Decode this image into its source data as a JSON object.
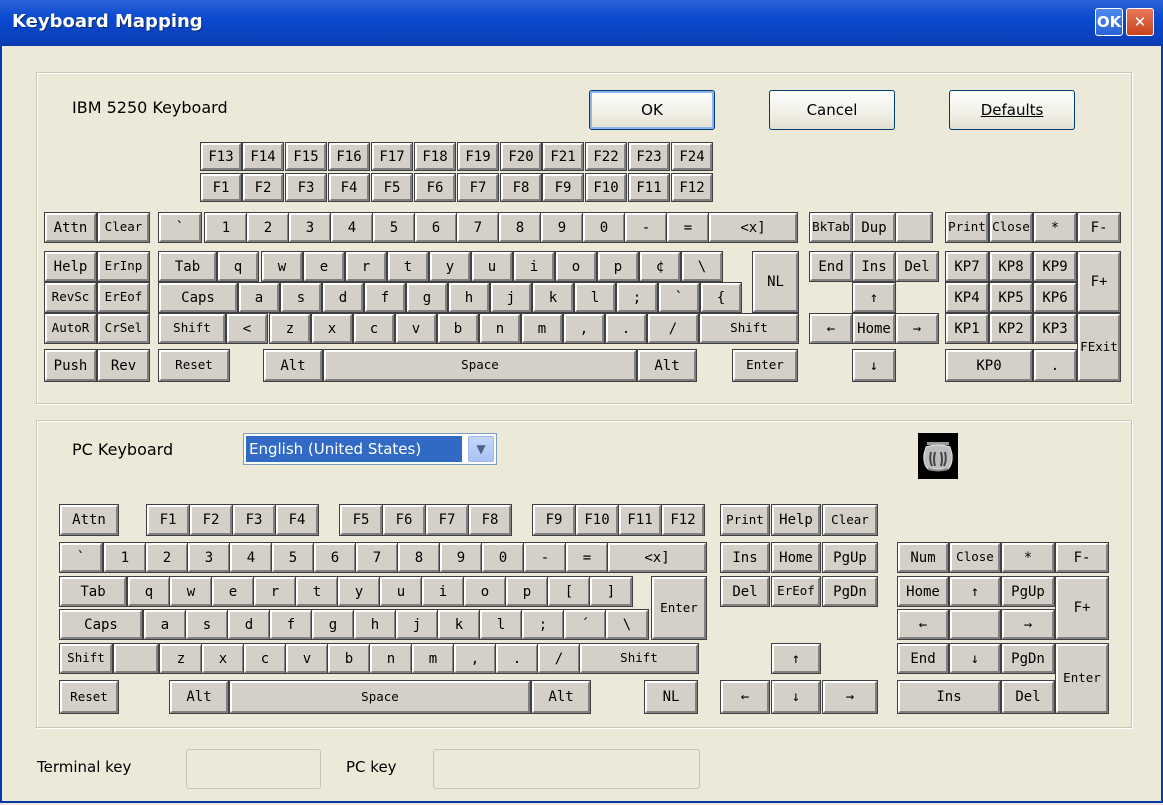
{
  "window": {
    "title": "Keyboard Mapping",
    "ok_label": "OK",
    "close_label": "✕"
  },
  "terminal": {
    "label": "IBM 5250 Keyboard",
    "buttons": {
      "ok": "OK",
      "cancel": "Cancel",
      "defaults": "Defaults"
    },
    "keys": [
      [
        "F13",
        "F14",
        "F15",
        "F16",
        "F17",
        "F18",
        "F19",
        "F20",
        "F21",
        "F22",
        "F23",
        "F24"
      ],
      [
        "F1",
        "F2",
        "F3",
        "F4",
        "F5",
        "F6",
        "F7",
        "F8",
        "F9",
        "F10",
        "F11",
        "F12"
      ],
      [
        "Attn",
        "Clear",
        "`",
        "1",
        "2",
        "3",
        "4",
        "5",
        "6",
        "7",
        "8",
        "9",
        "0",
        "-",
        "=",
        "<x]",
        "BkTab",
        "Dup",
        "",
        "Print",
        "Close",
        "*",
        "F-"
      ],
      [
        "Help",
        "ErInp",
        "Tab",
        "q",
        "w",
        "e",
        "r",
        "t",
        "y",
        "u",
        "i",
        "o",
        "p",
        "¢",
        "\\",
        "NL",
        "End",
        "Ins",
        "Del",
        "KP7",
        "KP8",
        "KP9",
        "F+"
      ],
      [
        "RevSc",
        "ErEof",
        "Caps",
        "a",
        "s",
        "d",
        "f",
        "g",
        "h",
        "j",
        "k",
        "l",
        ";",
        "`",
        "{",
        "↑",
        "KP4",
        "KP5",
        "KP6"
      ],
      [
        "AutoR",
        "CrSel",
        "Shift",
        "<",
        "z",
        "x",
        "c",
        "v",
        "b",
        "n",
        "m",
        ",",
        ".",
        "/",
        "Shift",
        "←",
        "Home",
        "→",
        "KP1",
        "KP2",
        "KP3",
        "FExit"
      ],
      [
        "Push",
        "Rev",
        "Reset",
        "Alt",
        "Space",
        "Alt",
        "Enter",
        "↓",
        "KP0",
        "."
      ]
    ]
  },
  "pc": {
    "label": "PC Keyboard",
    "layout_selected": "English (United States)",
    "keys": [
      [
        "Attn",
        "F1",
        "F2",
        "F3",
        "F4",
        "F5",
        "F6",
        "F7",
        "F8",
        "F9",
        "F10",
        "F11",
        "F12",
        "Print",
        "Help",
        "Clear"
      ],
      [
        "`",
        "1",
        "2",
        "3",
        "4",
        "5",
        "6",
        "7",
        "8",
        "9",
        "0",
        "-",
        "=",
        "<x]",
        "Ins",
        "Home",
        "PgUp",
        "Num",
        "Close",
        "*",
        "F-"
      ],
      [
        "Tab",
        "q",
        "w",
        "e",
        "r",
        "t",
        "y",
        "u",
        "i",
        "o",
        "p",
        "[",
        "]",
        "Enter",
        "Del",
        "ErEof",
        "PgDn",
        "Home",
        "↑",
        "PgUp",
        "F+"
      ],
      [
        "Caps",
        "a",
        "s",
        "d",
        "f",
        "g",
        "h",
        "j",
        "k",
        "l",
        ";",
        "´",
        "\\",
        "←",
        "",
        "→"
      ],
      [
        "Shift",
        "",
        "z",
        "x",
        "c",
        "v",
        "b",
        "n",
        "m",
        ",",
        ".",
        "/",
        "Shift",
        "↑",
        "End",
        "↓",
        "PgDn",
        "Enter"
      ],
      [
        "Reset",
        "Alt",
        "Space",
        "Alt",
        "NL",
        "←",
        "↓",
        "→",
        "Ins",
        "Del"
      ]
    ]
  },
  "footer": {
    "terminal_key_label": "Terminal key",
    "pc_key_label": "PC key",
    "terminal_key_value": "",
    "pc_key_value": ""
  }
}
